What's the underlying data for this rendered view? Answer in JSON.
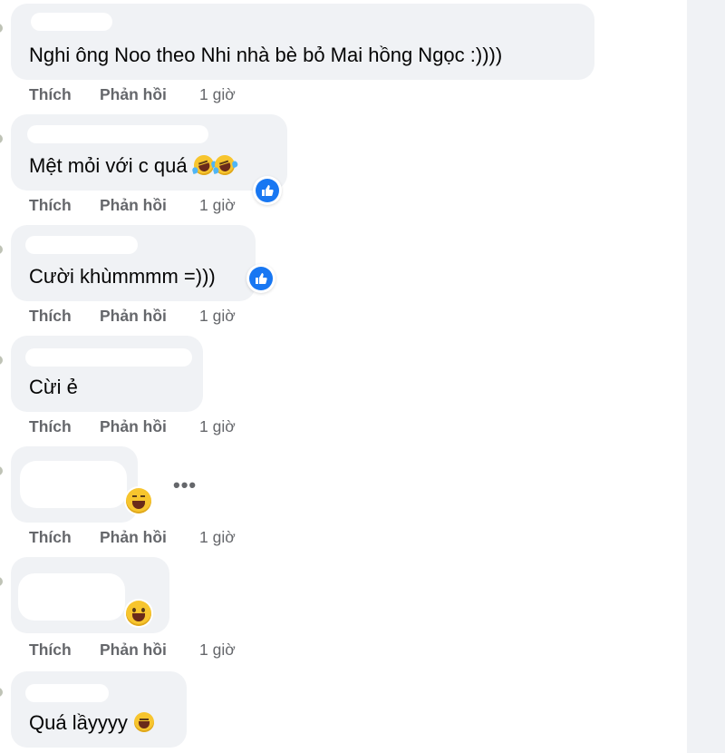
{
  "actions": {
    "like": "Thích",
    "reply": "Phản hồi",
    "time": "1 giờ"
  },
  "comments": [
    {
      "text": "Nghi ông Noo theo Nhi nhà bè bỏ Mai hồng Ngọc :))))",
      "emoji": [],
      "has_like_reaction": false
    },
    {
      "text": "Mệt mỏi với c quá",
      "emoji": [
        "rolling-on-floor-laughing",
        "rolling-on-floor-laughing"
      ],
      "has_like_reaction": true
    },
    {
      "text": "Cười khùmmmm =)))",
      "emoji": [],
      "has_like_reaction": true
    },
    {
      "text": "Cừi ẻ",
      "emoji": [],
      "has_like_reaction": false
    },
    {
      "text": "",
      "emoji": [
        "grinning-squinting-face"
      ],
      "has_like_reaction": false,
      "has_more_menu": true
    },
    {
      "text": "",
      "emoji": [
        "grinning-face"
      ],
      "has_like_reaction": false
    },
    {
      "text": "Quá lầyyyy",
      "emoji": [
        "grinning-squinting-face"
      ],
      "has_like_reaction": false
    }
  ],
  "colors": {
    "bubble": "#f0f2f5",
    "meta_text": "#65676b",
    "like_blue": "#1877f2"
  }
}
